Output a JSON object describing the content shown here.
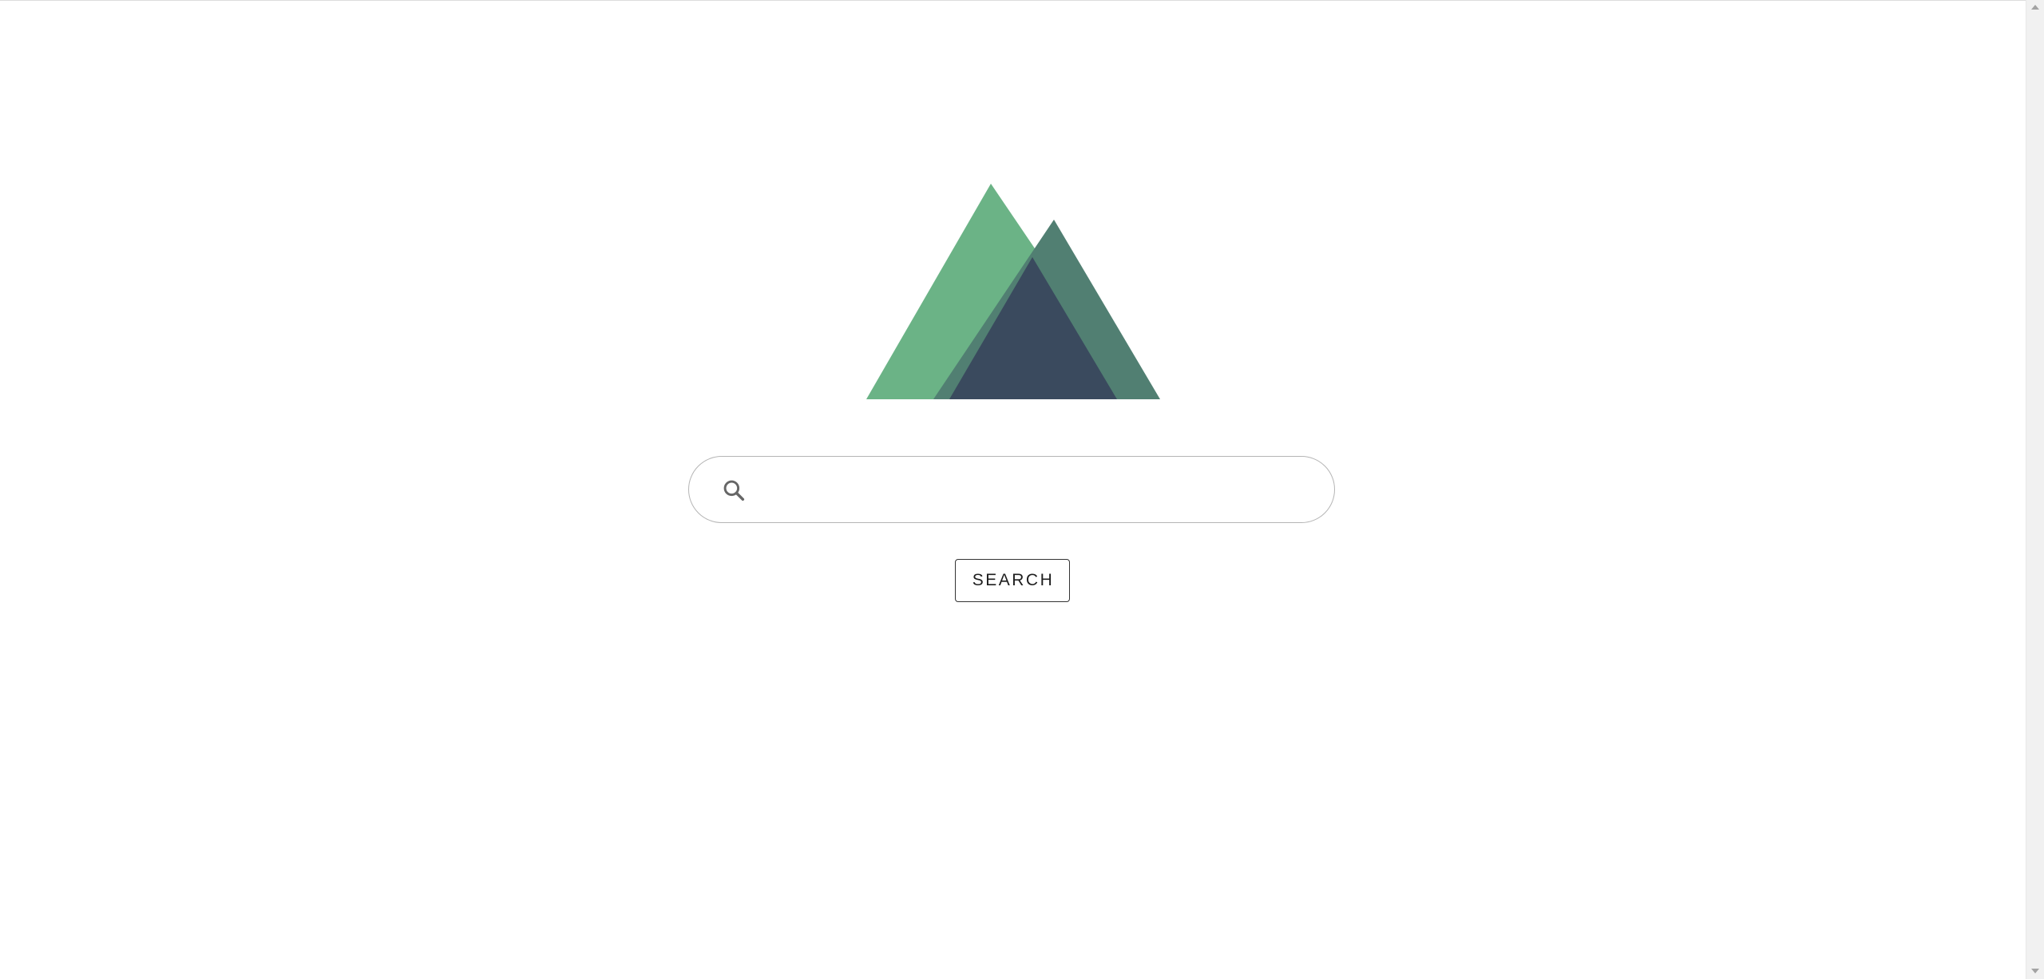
{
  "page": {
    "background": "#ffffff"
  },
  "logo": {
    "icon": "mountains-logo-icon",
    "colors": {
      "left_mountain": "#6bb386",
      "right_mountain": "#517f72",
      "overlap": "#3a4a5e"
    }
  },
  "search": {
    "icon": "search-icon",
    "value": "",
    "placeholder": "",
    "border_color": "#b5b5b5"
  },
  "search_button": {
    "label": "SEARCH"
  },
  "scrollbar": {
    "up_icon": "scroll-up-arrow-icon",
    "down_icon": "scroll-down-arrow-icon"
  }
}
